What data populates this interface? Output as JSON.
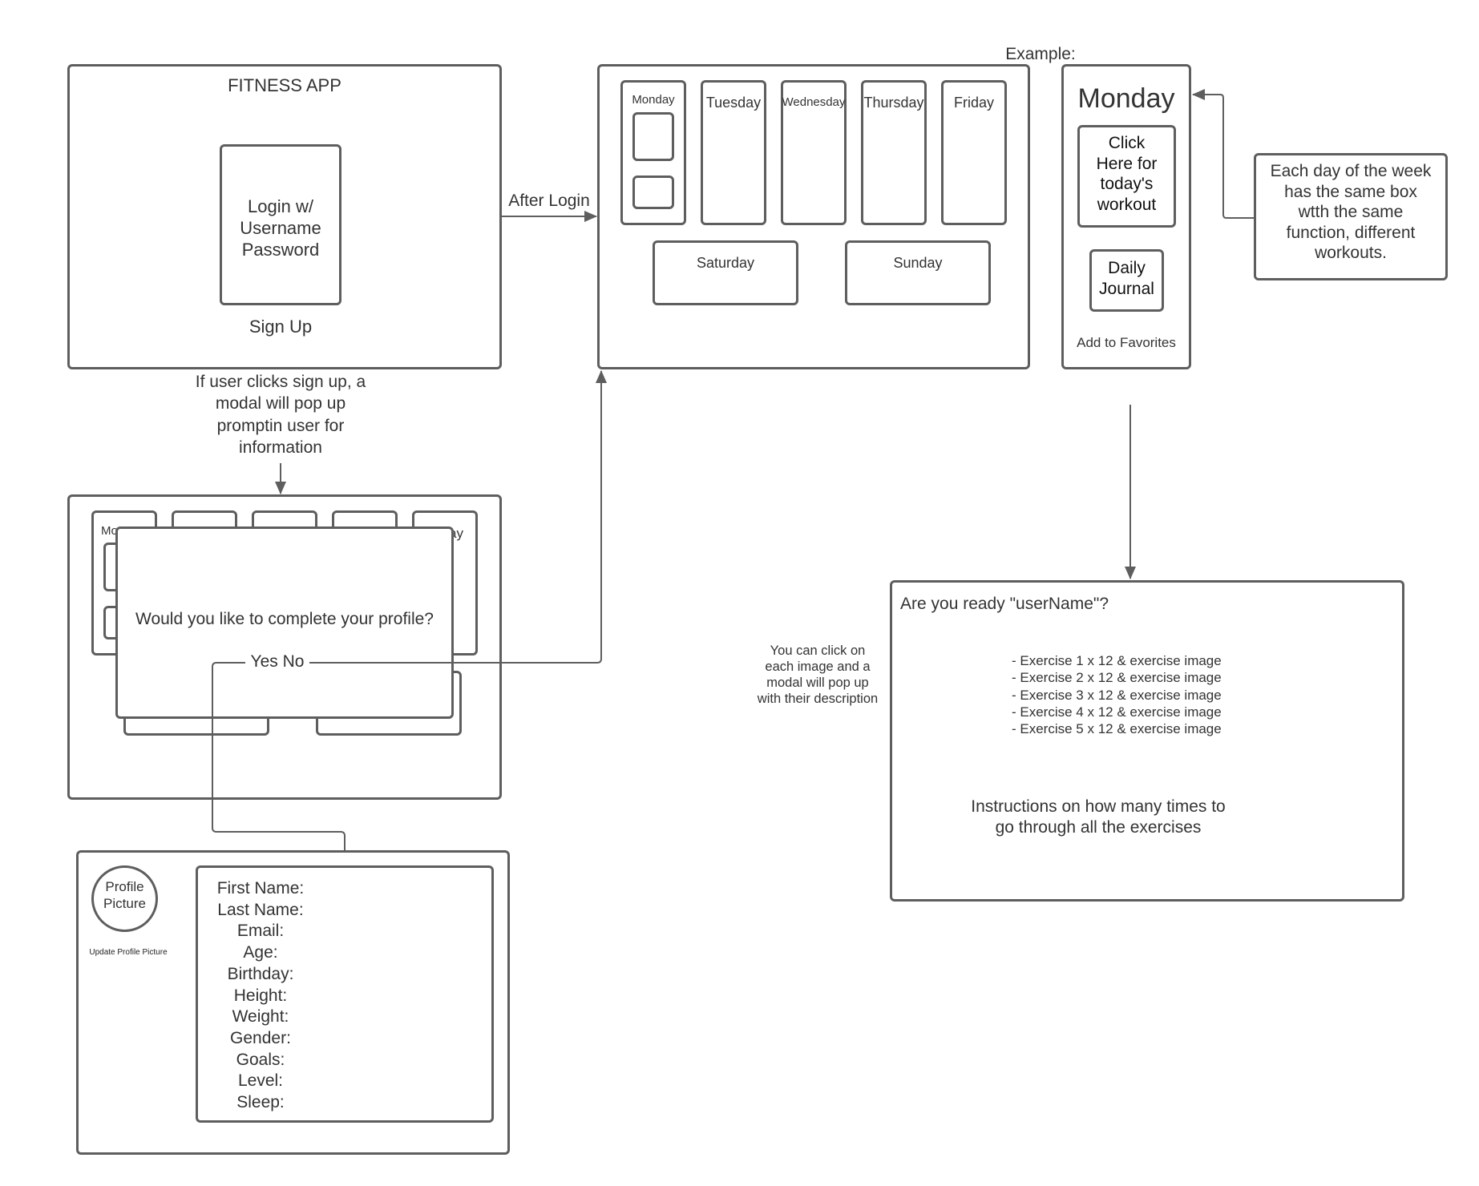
{
  "login_screen": {
    "title": "FITNESS APP",
    "login_box_label": "Login w/\nUsername\nPassword",
    "signup_label": "Sign Up"
  },
  "connectors": {
    "after_login_label": "After Login",
    "signup_note": "If user clicks sign up, a\nmodal will pop up\npromptin user for\ninformation",
    "example_label": "Example:",
    "exercise_click_note": "You can click on\neach image and a\nmodal will pop up\nwith their description"
  },
  "week_screen": {
    "days": [
      "Monday",
      "Tuesday",
      "Wednesday",
      "Thursday",
      "Friday"
    ],
    "weekend": [
      "Saturday",
      "Sunday"
    ]
  },
  "monday_example": {
    "title": "Monday",
    "workout_button": "Click\nHere for\ntoday's\nworkout",
    "journal_button": "Daily\nJournal",
    "favorites_link": "Add to Favorites"
  },
  "annotation": {
    "text": "Each day of the week\nhas the same box\nwtth the same\nfunction, different\nworkouts."
  },
  "profile_modal": {
    "background_partial_labels": [
      "Mo",
      "ay"
    ],
    "question": "Would you like to complete your profile?",
    "options_label": "Yes No"
  },
  "profile_form": {
    "picture_label": "Profile\nPicture",
    "update_picture_link": "Update Profile Picture",
    "fields": [
      "First Name:",
      "Last Name:",
      "Email:",
      "Age:",
      "Birthday:",
      "Height:",
      "Weight:",
      "Gender:",
      "Goals:",
      "Level:",
      "Sleep:"
    ]
  },
  "workout_screen": {
    "greeting": "Are you ready \"userName\"?",
    "exercises": [
      "- Exercise 1 x 12 & exercise image",
      "- Exercise 2 x 12 & exercise image",
      "- Exercise 3 x 12 & exercise image",
      "- Exercise 4 x 12 & exercise image",
      "- Exercise 5 x 12 & exercise image"
    ],
    "instructions": "Instructions on how many times to\ngo through all the exercises"
  },
  "colors": {
    "stroke": "#5e5e5e",
    "text": "#333333",
    "background": "#ffffff"
  }
}
